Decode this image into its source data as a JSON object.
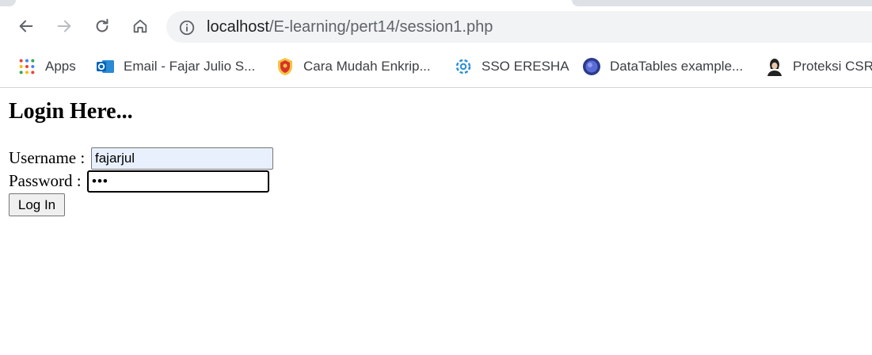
{
  "browser": {
    "url_host": "localhost",
    "url_path": "/E-learning/pert14/session1.php",
    "bookmarks": [
      {
        "label": "Apps",
        "icon": "apps-grid-icon"
      },
      {
        "label": "Email - Fajar Julio S...",
        "icon": "outlook-icon"
      },
      {
        "label": "Cara Mudah Enkrip...",
        "icon": "shield-logo-icon"
      },
      {
        "label": "SSO ERESHA",
        "icon": "sso-gear-icon"
      },
      {
        "label": "DataTables example...",
        "icon": "datatables-icon"
      },
      {
        "label": "Proteksi CSR",
        "icon": "person-icon"
      }
    ]
  },
  "page": {
    "heading": "Login Here...",
    "username_label": "Username :",
    "username_value": "fajarjul",
    "password_label": "Password :",
    "password_value": "•••",
    "login_button": "Log In"
  },
  "colors": {
    "autofill_bg": "#e8f0fe",
    "omnibox_bg": "#f1f3f4",
    "tabstrip_bg": "#dee1e6"
  }
}
